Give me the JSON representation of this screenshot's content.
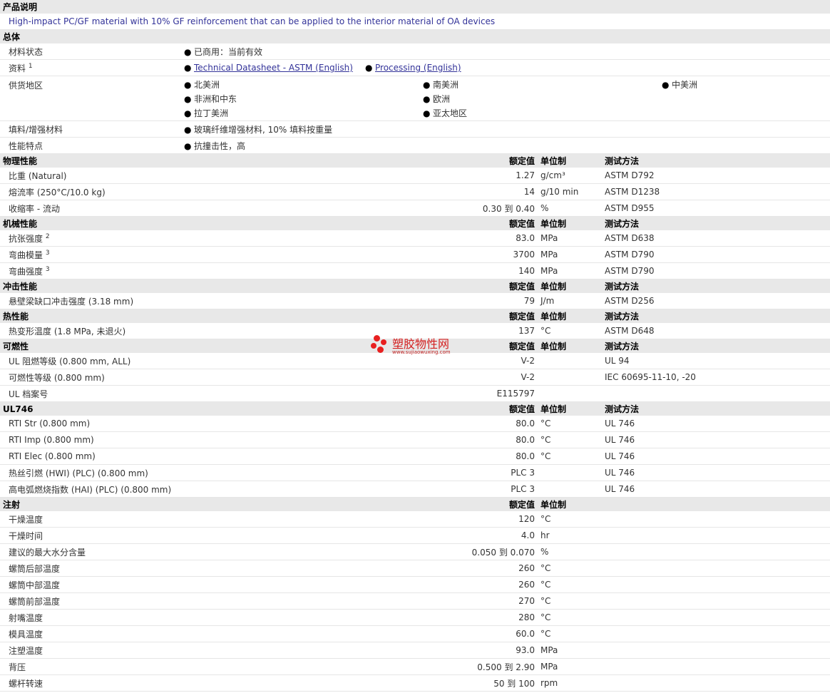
{
  "desc": {
    "title": "产品说明",
    "text": "High-impact PC/GF material with 10% GF reinforcement that can be applied to the interior material of OA devices"
  },
  "general": {
    "title": "总体",
    "status_label": "材料状态",
    "status_value": "已商用：当前有效",
    "docs_label": "资料",
    "docs_sup": "1",
    "doc1": "Technical Datasheet - ASTM (English)",
    "doc2": "Processing (English)",
    "supply_label": "供货地区",
    "regions": [
      "北美洲",
      "南美洲",
      "中美洲",
      "非洲和中东",
      "欧洲",
      "拉丁美洲",
      "亚太地区"
    ],
    "filler_label": "填料/增强材料",
    "filler_value": "玻璃纤维增强材料, 10% 填料按重量",
    "feature_label": "性能特点",
    "feature_value": "抗撞击性，高"
  },
  "cols": {
    "nominal": "额定值",
    "unit": "单位制",
    "method": "测试方法"
  },
  "physical": {
    "title": "物理性能",
    "rows": [
      {
        "name": "比重",
        "cond": "(Natural)",
        "value": "1.27",
        "unit": "g/cm³",
        "method": "ASTM D792"
      },
      {
        "name": "熔流率",
        "cond": "(250°C/10.0 kg)",
        "value": "14",
        "unit": "g/10 min",
        "method": "ASTM D1238"
      },
      {
        "name": "收缩率",
        "cond": "- 流动",
        "value": "0.30 到  0.40",
        "unit": "%",
        "method": "ASTM D955"
      }
    ]
  },
  "mechanical": {
    "title": "机械性能",
    "rows": [
      {
        "name": "抗张强度",
        "sup": "2",
        "value": "83.0",
        "unit": "MPa",
        "method": "ASTM D638"
      },
      {
        "name": "弯曲模量",
        "sup": "3",
        "value": "3700",
        "unit": "MPa",
        "method": "ASTM D790"
      },
      {
        "name": "弯曲强度",
        "sup": "3",
        "value": "140",
        "unit": "MPa",
        "method": "ASTM D790"
      }
    ]
  },
  "impact": {
    "title": "冲击性能",
    "rows": [
      {
        "name": "悬壁梁缺口冲击强度",
        "cond": "(3.18 mm)",
        "value": "79",
        "unit": "J/m",
        "method": "ASTM D256"
      }
    ]
  },
  "thermal": {
    "title": "热性能",
    "rows": [
      {
        "name": "热变形温度",
        "cond": "(1.8 MPa, 未退火)",
        "value": "137",
        "unit": "°C",
        "method": "ASTM D648"
      }
    ]
  },
  "flammability": {
    "title": "可燃性",
    "rows": [
      {
        "name": "UL 阻燃等级",
        "cond": "(0.800 mm, ALL)",
        "value": "V-2",
        "unit": "",
        "method": "UL 94"
      },
      {
        "name": "可燃性等级",
        "cond": "(0.800 mm)",
        "value": "V-2",
        "unit": "",
        "method": "IEC 60695-11-10, -20"
      },
      {
        "name": "UL 档案号",
        "cond": "",
        "value": "E115797",
        "unit": "",
        "method": ""
      }
    ]
  },
  "ul746": {
    "title": "UL746",
    "rows": [
      {
        "name": "RTI Str",
        "cond": "(0.800 mm)",
        "value": "80.0",
        "unit": "°C",
        "method": "UL 746"
      },
      {
        "name": "RTI Imp",
        "cond": "(0.800 mm)",
        "value": "80.0",
        "unit": "°C",
        "method": "UL 746"
      },
      {
        "name": "RTI Elec",
        "cond": "(0.800 mm)",
        "value": "80.0",
        "unit": "°C",
        "method": "UL 746"
      },
      {
        "name": "热丝引燃",
        "cond": "(HWI) (PLC) (0.800 mm)",
        "value": "PLC 3",
        "unit": "",
        "method": "UL 746"
      },
      {
        "name": "高电弧燃烧指数",
        "cond": "(HAI) (PLC) (0.800 mm)",
        "value": "PLC 3",
        "unit": "",
        "method": "UL 746"
      }
    ]
  },
  "injection": {
    "title": "注射",
    "rows": [
      {
        "name": "干燥温度",
        "value": "120",
        "unit": "°C"
      },
      {
        "name": "干燥时间",
        "value": "4.0",
        "unit": "hr"
      },
      {
        "name": "建议的最大水分含量",
        "value": "0.050 到  0.070",
        "unit": "%"
      },
      {
        "name": "螺筒后部温度",
        "value": "260",
        "unit": "°C"
      },
      {
        "name": "螺筒中部温度",
        "value": "260",
        "unit": "°C"
      },
      {
        "name": "螺筒前部温度",
        "value": "270",
        "unit": "°C"
      },
      {
        "name": "射嘴温度",
        "value": "280",
        "unit": "°C"
      },
      {
        "name": "模具温度",
        "value": "60.0",
        "unit": "°C"
      },
      {
        "name": "注塑温度",
        "value": "93.0",
        "unit": "MPa"
      },
      {
        "name": "背压",
        "value": "0.500 到  2.90",
        "unit": "MPa"
      },
      {
        "name": "螺杆转速",
        "value": "50 到  100",
        "unit": "rpm"
      }
    ]
  },
  "watermark": {
    "name": "塑胶物性网",
    "url": "www.sujiaowuxing.com",
    "color": "#e82020"
  }
}
